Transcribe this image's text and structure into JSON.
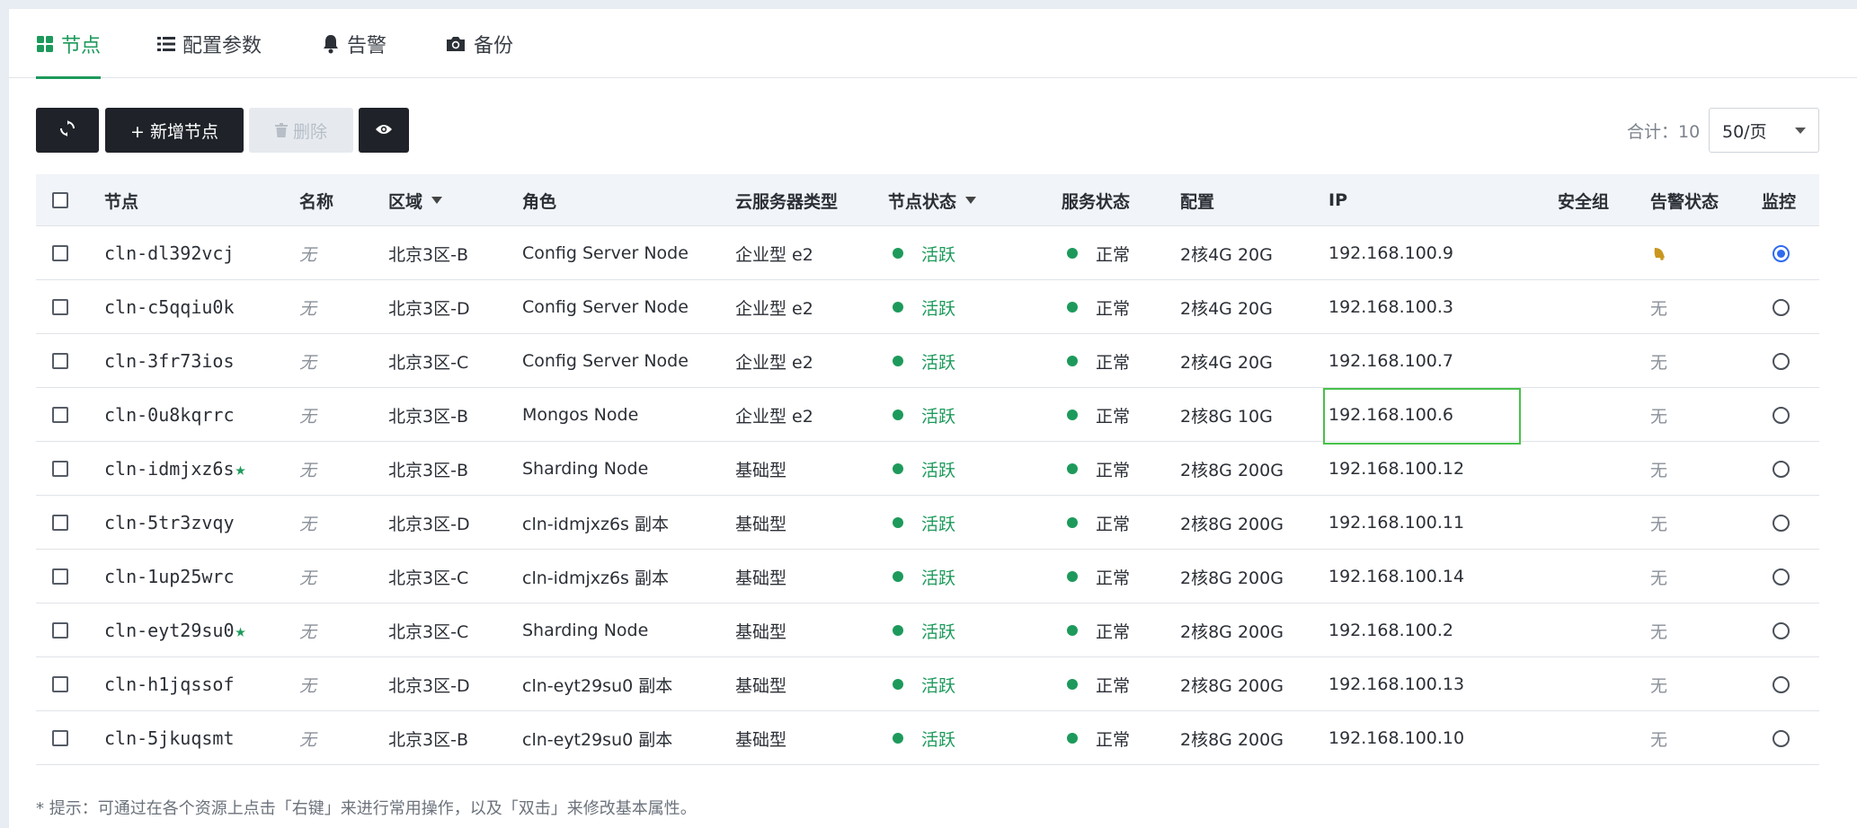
{
  "tabs": [
    {
      "label": "节点",
      "icon": "grid-icon",
      "active": true
    },
    {
      "label": "配置参数",
      "icon": "list-icon",
      "active": false
    },
    {
      "label": "告警",
      "icon": "bell-icon",
      "active": false
    },
    {
      "label": "备份",
      "icon": "camera-icon",
      "active": false
    }
  ],
  "toolbar": {
    "add_label": "+ 新增节点",
    "delete_label": "删除",
    "total_label": "合计：10",
    "page_size": "50/页"
  },
  "columns": [
    "节点",
    "名称",
    "区域",
    "角色",
    "云服务器类型",
    "节点状态",
    "服务状态",
    "配置",
    "IP",
    "安全组",
    "告警状态",
    "监控"
  ],
  "rows": [
    {
      "id": "cln-dl392vcj",
      "star": false,
      "name": "无",
      "zone": "北京3区-B",
      "role": "Config Server Node",
      "type": "企业型 e2",
      "node_status": "活跃",
      "service_status": "正常",
      "config": "2核4G 20G",
      "ip": "192.168.100.9",
      "alert": "",
      "alert_icon": "bell-icon",
      "monitor": true
    },
    {
      "id": "cln-c5qqiu0k",
      "star": false,
      "name": "无",
      "zone": "北京3区-D",
      "role": "Config Server Node",
      "type": "企业型 e2",
      "node_status": "活跃",
      "service_status": "正常",
      "config": "2核4G 20G",
      "ip": "192.168.100.3",
      "alert": "无",
      "alert_icon": "",
      "monitor": false
    },
    {
      "id": "cln-3fr73ios",
      "star": false,
      "name": "无",
      "zone": "北京3区-C",
      "role": "Config Server Node",
      "type": "企业型 e2",
      "node_status": "活跃",
      "service_status": "正常",
      "config": "2核4G 20G",
      "ip": "192.168.100.7",
      "alert": "无",
      "alert_icon": "",
      "monitor": false
    },
    {
      "id": "cln-0u8kqrrc",
      "star": false,
      "name": "无",
      "zone": "北京3区-B",
      "role": "Mongos Node",
      "type": "企业型 e2",
      "node_status": "活跃",
      "service_status": "正常",
      "config": "2核8G 10G",
      "ip": "192.168.100.6",
      "alert": "无",
      "alert_icon": "",
      "monitor": false
    },
    {
      "id": "cln-idmjxz6s",
      "star": true,
      "name": "无",
      "zone": "北京3区-B",
      "role": "Sharding Node",
      "type": "基础型",
      "node_status": "活跃",
      "service_status": "正常",
      "config": "2核8G 200G",
      "ip": "192.168.100.12",
      "alert": "无",
      "alert_icon": "",
      "monitor": false
    },
    {
      "id": "cln-5tr3zvqy",
      "star": false,
      "name": "无",
      "zone": "北京3区-D",
      "role": "cln-idmjxz6s 副本",
      "type": "基础型",
      "node_status": "活跃",
      "service_status": "正常",
      "config": "2核8G 200G",
      "ip": "192.168.100.11",
      "alert": "无",
      "alert_icon": "",
      "monitor": false
    },
    {
      "id": "cln-1up25wrc",
      "star": false,
      "name": "无",
      "zone": "北京3区-C",
      "role": "cln-idmjxz6s 副本",
      "type": "基础型",
      "node_status": "活跃",
      "service_status": "正常",
      "config": "2核8G 200G",
      "ip": "192.168.100.14",
      "alert": "无",
      "alert_icon": "",
      "monitor": false
    },
    {
      "id": "cln-eyt29su0",
      "star": true,
      "name": "无",
      "zone": "北京3区-C",
      "role": "Sharding Node",
      "type": "基础型",
      "node_status": "活跃",
      "service_status": "正常",
      "config": "2核8G 200G",
      "ip": "192.168.100.2",
      "alert": "无",
      "alert_icon": "",
      "monitor": false
    },
    {
      "id": "cln-h1jqssof",
      "star": false,
      "name": "无",
      "zone": "北京3区-D",
      "role": "cln-eyt29su0 副本",
      "type": "基础型",
      "node_status": "活跃",
      "service_status": "正常",
      "config": "2核8G 200G",
      "ip": "192.168.100.13",
      "alert": "无",
      "alert_icon": "",
      "monitor": false
    },
    {
      "id": "cln-5jkuqsmt",
      "star": false,
      "name": "无",
      "zone": "北京3区-B",
      "role": "cln-eyt29su0 副本",
      "type": "基础型",
      "node_status": "活跃",
      "service_status": "正常",
      "config": "2核8G 200G",
      "ip": "192.168.100.10",
      "alert": "无",
      "alert_icon": "",
      "monitor": false
    }
  ],
  "hint": "* 提示：可通过在各个资源上点击「右键」来进行常用操作，以及「双击」来修改基本属性。",
  "colors": {
    "accent": "#1d9a5b",
    "dark_button": "#1f2329",
    "radio_selected": "#2f6bef",
    "highlight_border": "#48c14b"
  }
}
